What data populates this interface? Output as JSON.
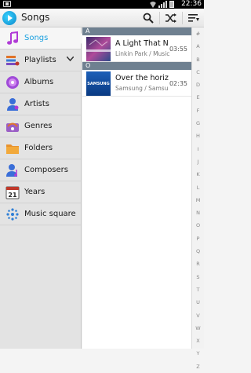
{
  "status": {
    "time": "22:36"
  },
  "header": {
    "title": "Songs"
  },
  "drawer": {
    "items": [
      {
        "label": "Songs",
        "icon": "music-note-icon",
        "selected": true
      },
      {
        "label": "Playlists",
        "icon": "playlists-icon",
        "has_dropdown": true
      },
      {
        "label": "Albums",
        "icon": "albums-disc-icon"
      },
      {
        "label": "Artists",
        "icon": "artist-person-icon"
      },
      {
        "label": "Genres",
        "icon": "genres-icon"
      },
      {
        "label": "Folders",
        "icon": "folder-icon"
      },
      {
        "label": "Composers",
        "icon": "composer-icon"
      },
      {
        "label": "Years",
        "icon": "calendar-icon",
        "badge": "21"
      },
      {
        "label": "Music square",
        "icon": "music-square-icon"
      }
    ]
  },
  "sections": [
    {
      "letter": "A",
      "tracks": [
        {
          "title": "A Light That N",
          "subtitle": "Linkin Park / Music",
          "duration": "03:55"
        }
      ]
    },
    {
      "letter": "O",
      "tracks": [
        {
          "title": "Over the horiz",
          "subtitle": "Samsung / Samsu",
          "duration": "02:35",
          "thumb_text": "SAMSUNG"
        }
      ]
    }
  ],
  "index_letters": [
    "#",
    "A",
    "B",
    "C",
    "D",
    "E",
    "F",
    "G",
    "H",
    "I",
    "J",
    "K",
    "L",
    "M",
    "N",
    "O",
    "P",
    "Q",
    "R",
    "S",
    "T",
    "U",
    "V",
    "W",
    "X",
    "Y",
    "Z"
  ],
  "colors": {
    "accent": "#1aa0e0",
    "section_header": "#6f8090"
  }
}
